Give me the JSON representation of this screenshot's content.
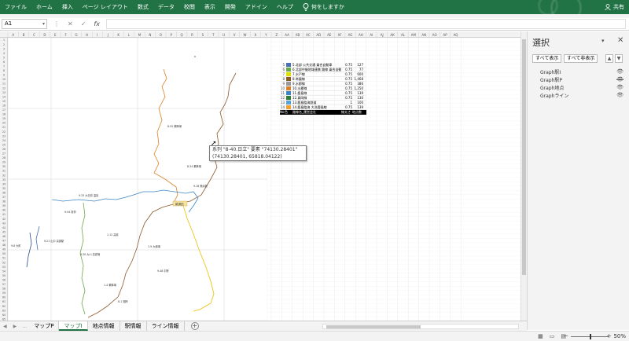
{
  "ribbon": {
    "tabs": [
      "ファイル",
      "ホーム",
      "挿入",
      "ページ レイアウト",
      "数式",
      "データ",
      "校閲",
      "表示",
      "開発",
      "アドイン",
      "ヘルプ"
    ],
    "tell_me": "何をしますか",
    "share": "共有",
    "color": "#217346"
  },
  "formula_bar": {
    "name_box": "A1",
    "cancel": "✕",
    "enter": "✓",
    "fx": "fx",
    "value": ""
  },
  "columns": [
    "A",
    "B",
    "C",
    "D",
    "E",
    "F",
    "G",
    "H",
    "I",
    "J",
    "K",
    "L",
    "M",
    "N",
    "O",
    "P",
    "Q",
    "R",
    "S",
    "T",
    "U",
    "V",
    "W",
    "X",
    "Y",
    "Z",
    "AA",
    "AB",
    "AC",
    "AD",
    "AE",
    "AF",
    "AG",
    "AH",
    "AI",
    "AJ",
    "AK",
    "AL",
    "AM",
    "AN",
    "AO",
    "AP",
    "AQ"
  ],
  "rows": [
    "1",
    "2",
    "3",
    "4",
    "5",
    "6",
    "7",
    "8",
    "9",
    "10",
    "11",
    "12",
    "13",
    "14",
    "15",
    "16",
    "17",
    "18",
    "19",
    "20",
    "21",
    "22",
    "23",
    "24",
    "25",
    "26",
    "27",
    "28",
    "29",
    "30",
    "31",
    "32",
    "33",
    "34",
    "35",
    "36",
    "37",
    "38",
    "39",
    "40",
    "41",
    "42",
    "43",
    "44",
    "45",
    "46",
    "47",
    "48",
    "49",
    "50",
    "51",
    "52",
    "53",
    "54",
    "55",
    "56",
    "57",
    "58",
    "59",
    "60",
    "61",
    "62",
    "63",
    "64",
    "65"
  ],
  "map": {
    "station_label": "新浦田",
    "labels": [
      "8-55 乗降場",
      "8-34 乗降場",
      "9-18 美浜駅",
      "9-33 大日前 温泉",
      "9-94 常滑",
      "9-21 山中 高原駅",
      "9-8 大町",
      "1-12 高原",
      "1-9 大湯場",
      "9-30 大川 高原場",
      "9-48 中野",
      "1-4 乗降場",
      "8-1 湖岸"
    ]
  },
  "legend_table": {
    "header": [
      "No",
      "色",
      "路線名_運営会社",
      "線太さ",
      "地点数"
    ],
    "rows": [
      {
        "no": "5",
        "color": "#4a6fb3",
        "name": "5.北部 公共交通 乗合自動車",
        "w": "0.75",
        "n": "127"
      },
      {
        "no": "6",
        "color": "#6aa84f",
        "name": "6.北部中継地域連携 路線 乗合自動車",
        "w": "0.75",
        "n": "77"
      },
      {
        "no": "7",
        "color": "#e0e000",
        "name": "7.水戸線",
        "w": "0.75",
        "n": "600"
      },
      {
        "no": "8",
        "color": "#8b5a2b",
        "name": "8.常磐線",
        "w": "0.75",
        "n": "1,468"
      },
      {
        "no": "9",
        "color": "#999999",
        "name": "9.水郡線",
        "w": "0.75",
        "n": "386"
      },
      {
        "no": "10",
        "color": "#d9822b",
        "name": "10.水郡線",
        "w": "0.75",
        "n": "1,250"
      },
      {
        "no": "11",
        "color": "#3d85c6",
        "name": "11.鹿島線",
        "w": "0.75",
        "n": "139"
      },
      {
        "no": "12",
        "color": "#2e7d32",
        "name": "12.真岡線",
        "w": "0.75",
        "n": "130"
      },
      {
        "no": "13",
        "color": "#5aa0d8",
        "name": "13.鹿島臨海鉄道",
        "w": "1",
        "n": "100"
      },
      {
        "no": "14",
        "color": "#f0a030",
        "name": "14.鹿島臨海 大洗鹿島線",
        "w": "0.75",
        "n": "139"
      }
    ]
  },
  "tooltip": {
    "line1": "系列 \"8-40.日立\" 要素 \"74130.28401\"",
    "line2": "(74130.28401, 65818.04122)"
  },
  "selection_pane": {
    "title": "選択",
    "show_all": "すべて表示",
    "hide_all": "すべて非表示",
    "items": [
      {
        "name": "Graph駅I",
        "eye": "visible-eye-icon"
      },
      {
        "name": "Graph駅P",
        "eye": "hidden-eye-icon"
      },
      {
        "name": "Graph地点",
        "eye": "visible-eye-icon"
      },
      {
        "name": "Graphライン",
        "eye": "visible-eye-icon"
      }
    ]
  },
  "sheet_tabs": [
    {
      "label": "マップP",
      "active": false
    },
    {
      "label": "マップI",
      "active": true
    },
    {
      "label": "地点情報",
      "active": false
    },
    {
      "label": "駅情報",
      "active": false
    },
    {
      "label": "ライン情報",
      "active": false
    }
  ],
  "status": {
    "zoom": "50%"
  }
}
